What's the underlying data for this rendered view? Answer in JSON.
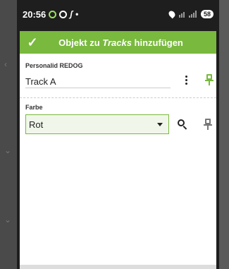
{
  "status_bar": {
    "time": "20:56",
    "battery": "58"
  },
  "dialog": {
    "title_prefix": "Objekt zu ",
    "title_emphasis": "Tracks",
    "title_suffix": " hinzufügen",
    "confirm_icon": "check-icon"
  },
  "fields": {
    "personal_id": {
      "label": "Personalid REDOG",
      "value": "Track A"
    },
    "color": {
      "label": "Farbe",
      "value": "Rot"
    }
  },
  "colors": {
    "accent": "#79b93e",
    "select_bg": "#f0f7ea"
  }
}
